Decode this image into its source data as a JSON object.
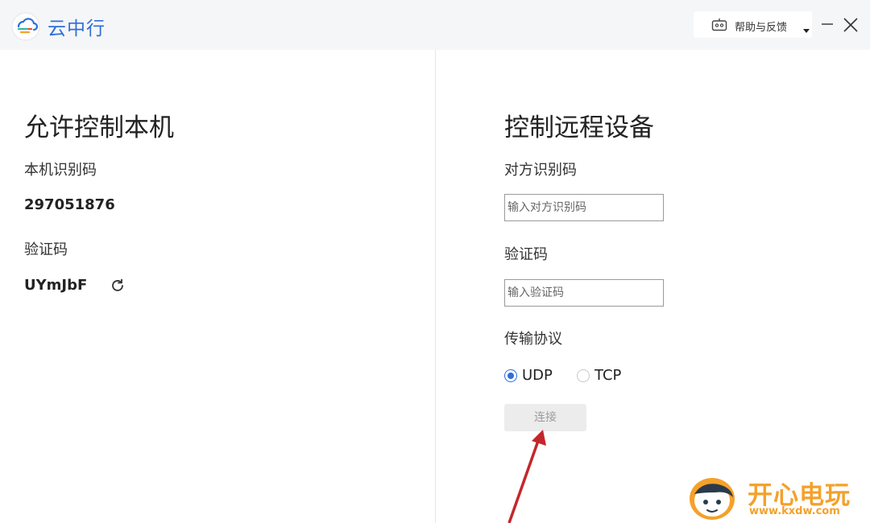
{
  "app": {
    "name": "云中行",
    "logo_colors": [
      "#2f6fd6",
      "#34b7a7",
      "#f4a12a",
      "#e2533f"
    ]
  },
  "titlebar": {
    "help_label": "帮助与反馈",
    "help_icon": "robot-icon",
    "minimize_icon": "minimize-icon",
    "close_icon": "close-icon"
  },
  "left_panel": {
    "title": "允许控制本机",
    "id_label": "本机识别码",
    "id_value": "297051876",
    "code_label": "验证码",
    "code_value": "UYmJbF",
    "refresh_icon": "refresh-icon"
  },
  "right_panel": {
    "title": "控制远程设备",
    "peer_id_label": "对方识别码",
    "peer_id_placeholder": "输入对方识别码",
    "peer_code_label": "验证码",
    "peer_code_placeholder": "输入验证码",
    "protocol_label": "传输协议",
    "protocols": [
      {
        "label": "UDP",
        "selected": true
      },
      {
        "label": "TCP",
        "selected": false
      }
    ],
    "connect_label": "连接"
  },
  "watermark": {
    "text": "开心电玩",
    "url": "www.kxdw.com"
  },
  "colors": {
    "accent": "#2f6fd6",
    "annotation": "#c4272b",
    "watermark": "#f4a12a"
  }
}
